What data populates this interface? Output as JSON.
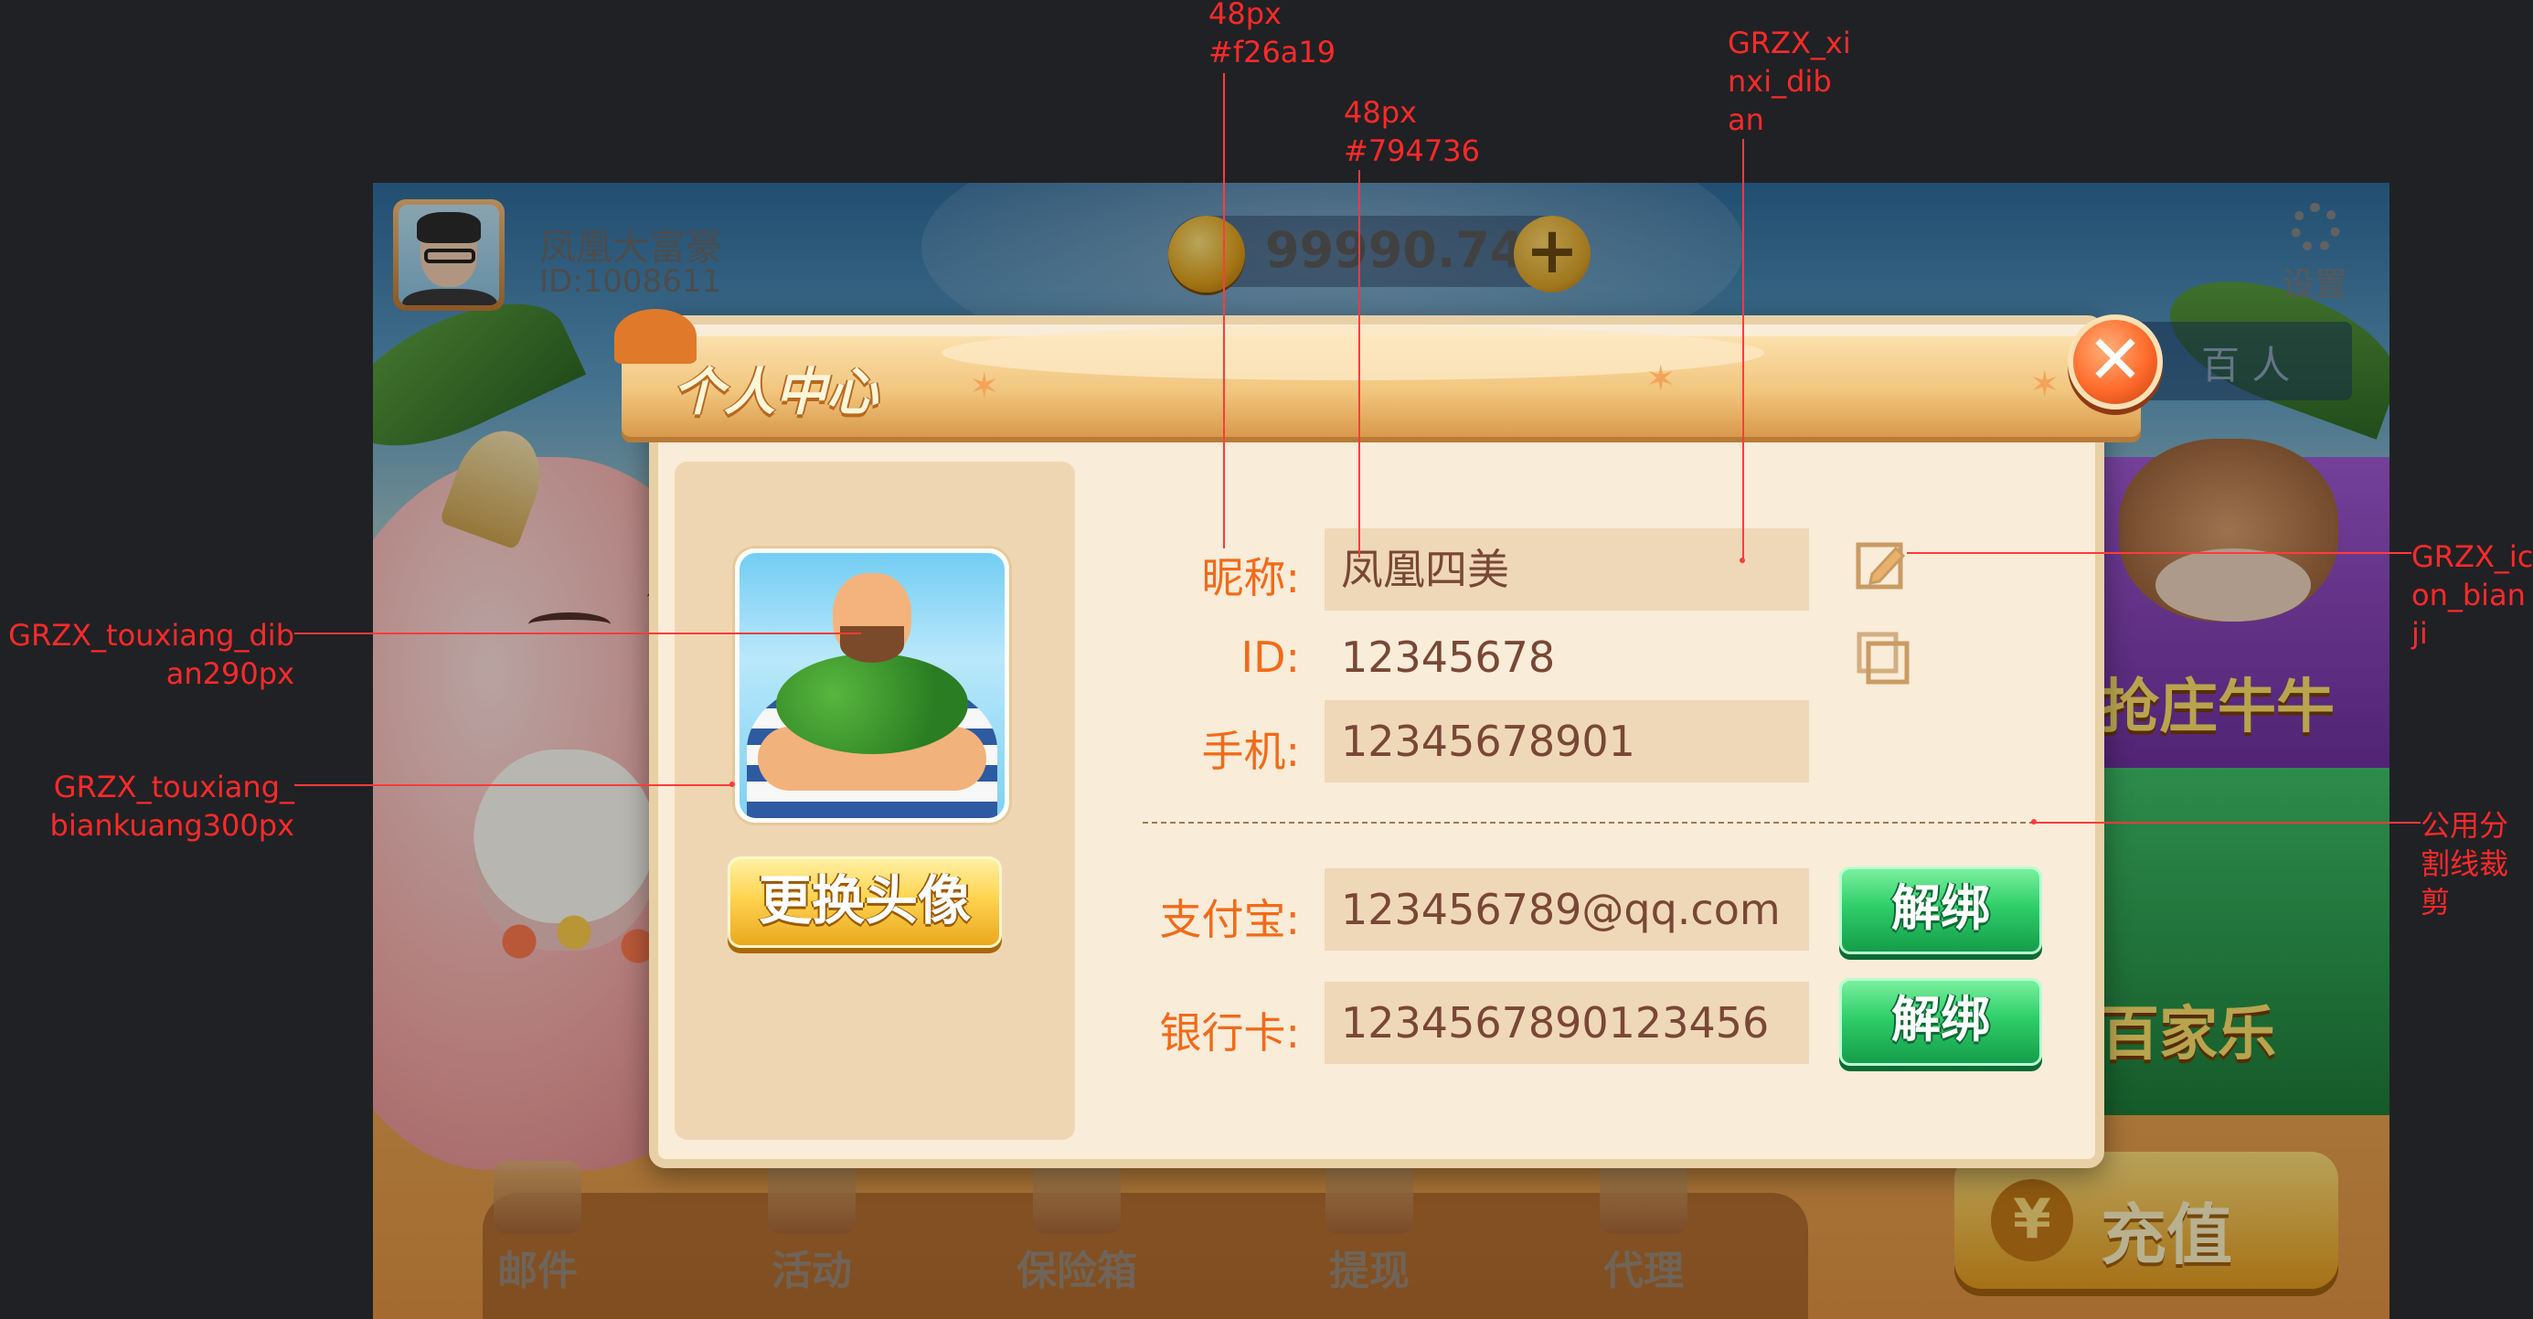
{
  "top_bar": {
    "player_name": "凤凰大富豪",
    "player_id": "ID:1008611",
    "coins": "99990.74",
    "coin_plus": "+",
    "settings_label": "设置",
    "tab_right": "百 人"
  },
  "game_cards": [
    {
      "title": "抢庄牛牛"
    },
    {
      "title": "百家乐"
    }
  ],
  "bottom_nav": [
    {
      "label": "邮件",
      "icon": "mail-icon"
    },
    {
      "label": "活动",
      "icon": "gift-icon"
    },
    {
      "label": "保险箱",
      "icon": "safe-icon"
    },
    {
      "label": "提现",
      "icon": "withdraw-icon"
    },
    {
      "label": "代理",
      "icon": "agent-icon"
    }
  ],
  "recharge": {
    "label": "充值",
    "icon_glyph": "¥"
  },
  "dialog": {
    "title": "个人中心",
    "close_glyph": "✕",
    "change_avatar_label": "更换头像",
    "fields": {
      "nickname": {
        "label": "昵称:",
        "value": "凤凰四美"
      },
      "id": {
        "label": "ID:",
        "value": "12345678"
      },
      "phone": {
        "label": "手机:",
        "value": "12345678901"
      },
      "alipay": {
        "label": "支付宝:",
        "value": "123456789@qq.com"
      },
      "bank": {
        "label": "银行卡:",
        "value": "1234567890123456"
      }
    },
    "unbind_label": "解绑"
  },
  "annotations": {
    "label_style": "48px\n#f26a19",
    "value_style": "48px\n#794736",
    "info_bg": "GRZX_xi\nnxi_dib\nan",
    "edit_icon": "GRZX_ic\non_bian\nji",
    "avatar_bg": "GRZX_touxiang_dib\nan290px",
    "avatar_frame": "GRZX_touxiang_\nbiankuang300px",
    "divider": "公用分\n割线裁\n剪"
  },
  "colors": {
    "label": "#f26a19",
    "value": "#794736",
    "annotation": "#ff2a2a"
  }
}
